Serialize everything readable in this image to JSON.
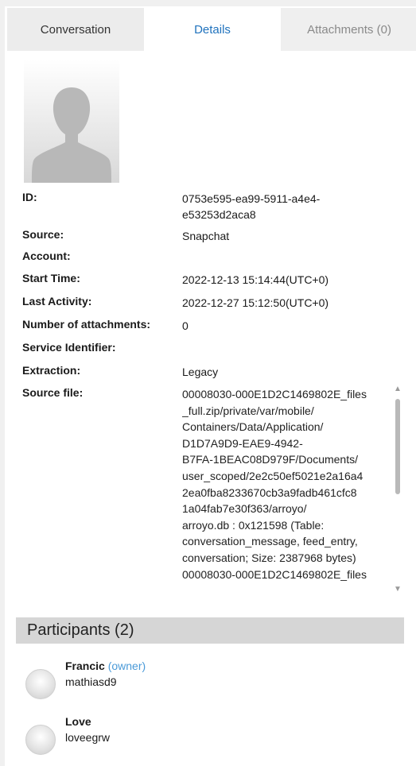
{
  "tabs": [
    {
      "label": "Conversation",
      "active": false
    },
    {
      "label": "Details",
      "active": true
    },
    {
      "label": "Attachments (0)",
      "active": false
    }
  ],
  "details": {
    "id_label": "ID:",
    "id_value_1": "0753e595-ea99-5911-a4e4-",
    "id_value_2": "e53253d2aca8",
    "source_label": "Source:",
    "source_value": "Snapchat",
    "account_label": "Account:",
    "account_value": "",
    "start_time_label": "Start Time:",
    "start_time_value": "2022-12-13 15:14:44(UTC+0)",
    "last_activity_label": "Last Activity:",
    "last_activity_value": "2022-12-27 15:12:50(UTC+0)",
    "attachments_label": "Number of attachments:",
    "attachments_value": "0",
    "service_identifier_label": "Service Identifier:",
    "service_identifier_value": "",
    "extraction_label": "Extraction:",
    "extraction_value": "Legacy",
    "source_file_label": "Source file:",
    "source_file_lines": [
      "00008030-000E1D2C1469802E_files",
      "_full.zip/private/var/mobile/",
      "Containers/Data/Application/",
      "D1D7A9D9-EAE9-4942-",
      "B7FA-1BEAC08D979F/Documents/",
      "user_scoped/2e2c50ef5021e2a16a4",
      "2ea0fba8233670cb3a9fadb461cfc8",
      "1a04fab7e30f363/arroyo/",
      "arroyo.db : 0x121598 (Table:",
      "conversation_message, feed_entry,",
      "conversation; Size: 2387968 bytes)",
      "00008030-000E1D2C1469802E_files"
    ]
  },
  "participants": {
    "header": "Participants (2)",
    "items": [
      {
        "name": "Francic",
        "role": "(owner)",
        "username": "mathiasd9"
      },
      {
        "name": "Love",
        "role": "",
        "username": "loveegrw"
      }
    ]
  }
}
